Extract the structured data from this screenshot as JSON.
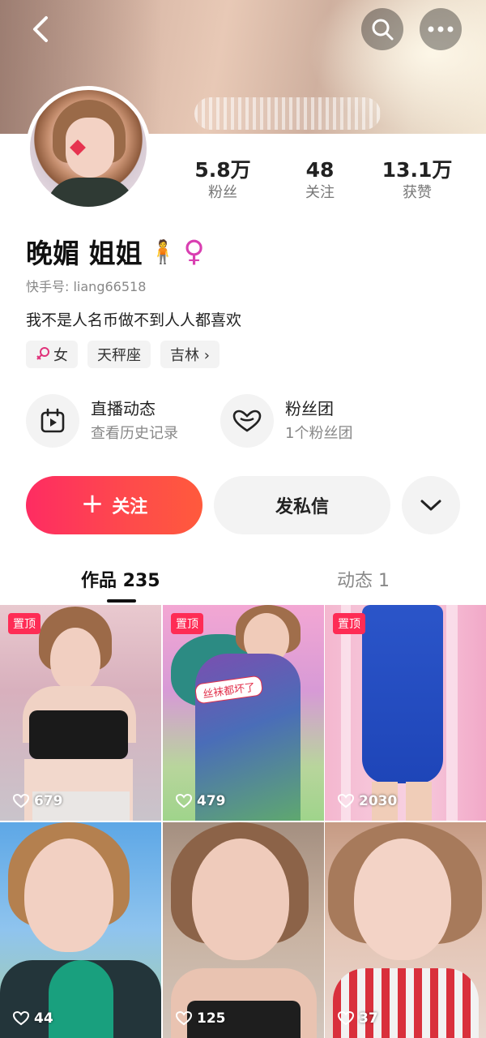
{
  "header": {
    "back_icon": "chevron-left-icon",
    "search_icon": "search-icon",
    "more_icon": "ellipsis-icon"
  },
  "profile": {
    "name": "晚媚 姐姐",
    "name_emoji": "🧍",
    "gender_symbol": "♀",
    "kuaishou_id": "快手号: liang66518",
    "bio": "我不是人名币做不到人人都喜欢"
  },
  "stats": [
    {
      "value": "5.8万",
      "label": "粉丝"
    },
    {
      "value": "48",
      "label": "关注"
    },
    {
      "value": "13.1万",
      "label": "获赞"
    }
  ],
  "tags": [
    {
      "label": "女",
      "icon": "female-icon"
    },
    {
      "label": "天秤座"
    },
    {
      "label": "吉林 ›"
    }
  ],
  "features": [
    {
      "title": "直播动态",
      "subtitle": "查看历史记录",
      "icon": "calendar-play-icon"
    },
    {
      "title": "粉丝团",
      "subtitle": "1个粉丝团",
      "icon": "heart-badge-icon"
    }
  ],
  "actions": {
    "follow_plus": "+",
    "follow_label": "关注",
    "message_label": "发私信",
    "more_icon": "chevron-down-icon"
  },
  "tabs": [
    {
      "label": "作品 235",
      "active": true
    },
    {
      "label": "动态 1",
      "active": false
    }
  ],
  "videos": [
    {
      "pinned": true,
      "pin_label": "置顶",
      "likes": "679"
    },
    {
      "pinned": true,
      "pin_label": "置顶",
      "likes": "479",
      "caption": "丝袜都坏了"
    },
    {
      "pinned": true,
      "pin_label": "置顶",
      "likes": "2030"
    },
    {
      "pinned": false,
      "likes": "44"
    },
    {
      "pinned": false,
      "likes": "125"
    },
    {
      "pinned": false,
      "likes": "37"
    }
  ],
  "colors": {
    "accent": "#fe2c55",
    "follow_gradient_start": "#fe2c62",
    "follow_gradient_end": "#ff5a3c",
    "female_symbol": "#d93fb1"
  }
}
